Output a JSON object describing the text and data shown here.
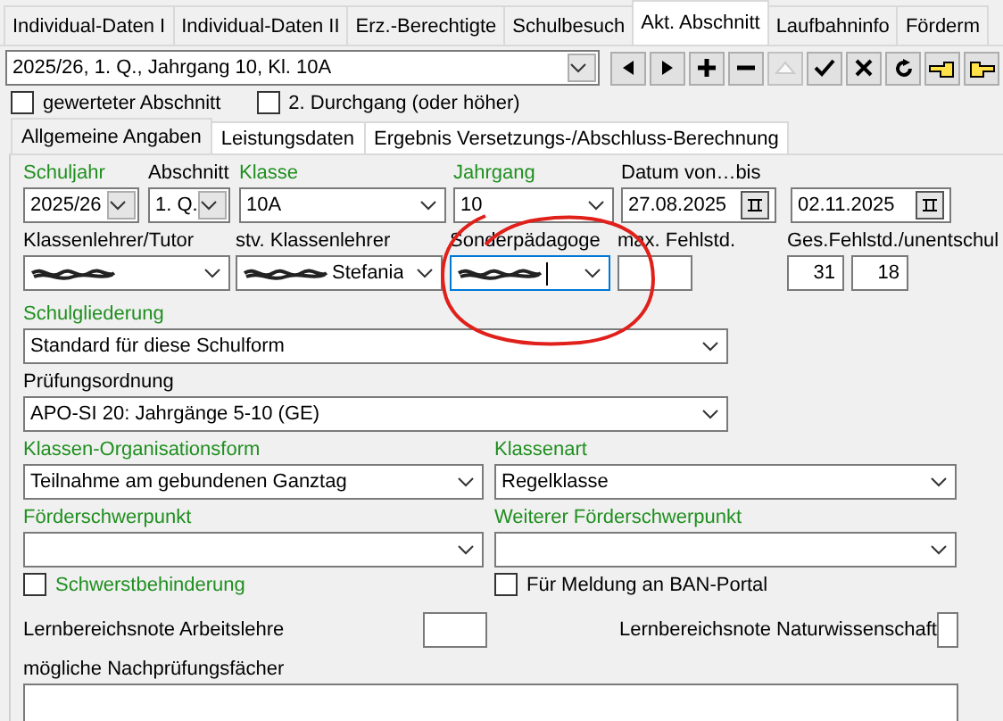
{
  "tabs": [
    {
      "label": "Individual-Daten I",
      "selected": false
    },
    {
      "label": "Individual-Daten II",
      "selected": false
    },
    {
      "label": "Erz.-Berechtigte",
      "selected": false
    },
    {
      "label": "Schulbesuch",
      "selected": false
    },
    {
      "label": "Akt. Abschnitt",
      "selected": true
    },
    {
      "label": "Laufbahninfo",
      "selected": false
    },
    {
      "label": "Förderm",
      "selected": false
    }
  ],
  "record_selector": {
    "value": "2025/26, 1. Q., Jahrgang 10, Kl. 10A"
  },
  "toolbar_buttons": [
    {
      "kind": "prev",
      "disabled": false
    },
    {
      "kind": "next",
      "disabled": false
    },
    {
      "kind": "add",
      "disabled": false
    },
    {
      "kind": "remove",
      "disabled": false
    },
    {
      "kind": "up",
      "disabled": true
    },
    {
      "kind": "confirm",
      "disabled": false
    },
    {
      "kind": "cancel",
      "disabled": false
    },
    {
      "kind": "refresh",
      "disabled": false
    },
    {
      "kind": "hand_left",
      "disabled": false
    },
    {
      "kind": "hand_right",
      "disabled": false
    }
  ],
  "section_checkboxes": [
    {
      "label": "gewerteter Abschnitt",
      "checked": false
    },
    {
      "label": "2. Durchgang (oder höher)",
      "checked": false
    }
  ],
  "subtabs": [
    {
      "label": "Allgemeine Angaben",
      "selected": true
    },
    {
      "label": "Leistungsdaten",
      "selected": false
    },
    {
      "label": "Ergebnis Versetzungs-/Abschluss-Berechnung",
      "selected": false
    }
  ],
  "form_rows": [
    [
      {
        "kind": "combo",
        "label": "Schuljahr",
        "value": "2025/26",
        "required": true
      },
      {
        "kind": "combo",
        "label": "Abschnitt",
        "value": "1. Q.",
        "required": false
      },
      {
        "kind": "combo",
        "label": "Klasse",
        "value": "10A",
        "required": true
      },
      {
        "kind": "combo",
        "label": "Jahrgang",
        "value": "10",
        "required": true
      },
      {
        "kind": "date",
        "label": "Datum von…bis",
        "value": "27.08.2025",
        "required": false
      },
      {
        "kind": "date",
        "value": "02.11.2025"
      }
    ],
    [
      {
        "kind": "combo",
        "label": "Klassenlehrer/Tutor",
        "redacted": true,
        "required": false
      },
      {
        "kind": "combo",
        "label": "stv. Klassenlehrer",
        "value": "Stefania",
        "redacted": true,
        "required": false
      },
      {
        "kind": "combo",
        "label": "Sonderpädagoge",
        "redacted": true,
        "focused": true,
        "required": false
      },
      {
        "kind": "text",
        "label": "max. Fehlstd.",
        "required": false
      },
      {
        "kind": "pair",
        "label": "Ges.Fehlstd./unentschul",
        "values": [
          "31",
          "18"
        ],
        "required": false
      }
    ],
    [
      {
        "kind": "combo",
        "label": "Schulgliederung",
        "value": "Standard für diese Schulform",
        "required": true
      }
    ],
    [
      {
        "kind": "combo",
        "label": "Prüfungsordnung",
        "value": "APO-SI 20: Jahrgänge 5-10 (GE)",
        "required": false
      }
    ],
    [
      {
        "kind": "combo",
        "label": "Klassen-Organisationsform",
        "value": "Teilnahme am gebundenen Ganztag",
        "required": true
      },
      {
        "kind": "combo",
        "label": "Klassenart",
        "value": "Regelklasse",
        "required": true
      }
    ],
    [
      {
        "kind": "combo",
        "label": "Förderschwerpunkt",
        "required": true
      },
      {
        "kind": "combo",
        "label": "Weiterer Förderschwerpunkt",
        "required": true
      }
    ]
  ],
  "flags": [
    {
      "label": "Schwerstbehinderung",
      "checked": false,
      "required": true
    },
    {
      "label": "Für Meldung an BAN-Portal",
      "checked": false,
      "required": false
    }
  ],
  "grades": [
    {
      "label": "Lernbereichsnote Arbeitslehre"
    },
    {
      "label": "Lernbereichsnote Naturwissenschaft"
    }
  ],
  "retest_subjects": {
    "label": "mögliche Nachprüfungsfächer"
  },
  "annotation": {
    "kind": "circle"
  }
}
